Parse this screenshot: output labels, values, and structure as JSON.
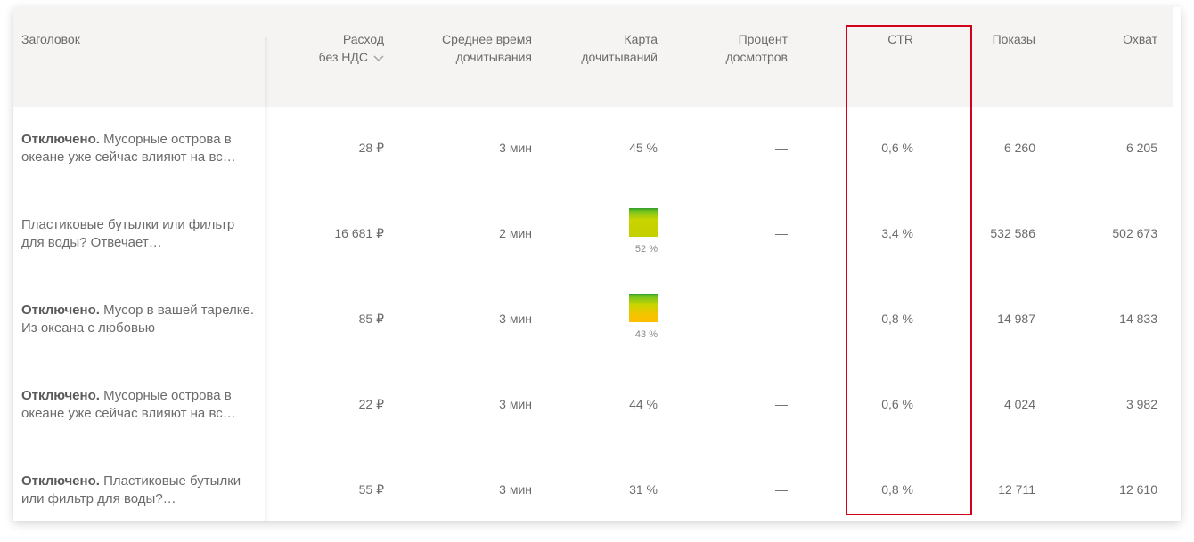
{
  "columns": {
    "title": "Заголовок",
    "expense_line1": "Расход",
    "expense_line2": "без НДС",
    "avg_time_line1": "Среднее время",
    "avg_time_line2": "дочитывания",
    "map_line1": "Карта",
    "map_line2": "дочитываний",
    "percent_line1": "Процент",
    "percent_line2": "досмотров",
    "ctr": "CTR",
    "shows": "Показы",
    "reach": "Охват"
  },
  "rows": [
    {
      "status": "Отключено.",
      "title": " Мусорные острова в океане уже сейчас влияют на вс…",
      "expense": "28 ₽",
      "time": "3 мин",
      "map": "45 %",
      "map_fill": null,
      "percent": "—",
      "ctr": "0,6 %",
      "shows": "6 260",
      "reach": "6 205"
    },
    {
      "status": "",
      "title": "Пластиковые бутылки или фильтр для воды? Отвечает…",
      "expense": "16 681 ₽",
      "time": "2 мин",
      "map": "52 %",
      "map_fill": 0.52,
      "percent": "—",
      "ctr": "3,4 %",
      "shows": "532 586",
      "reach": "502 673"
    },
    {
      "status": "Отключено.",
      "title": " Мусор в вашей тарелке. Из океана с любовью",
      "expense": "85 ₽",
      "time": "3 мин",
      "map": "43 %",
      "map_fill": 0.43,
      "percent": "—",
      "ctr": "0,8 %",
      "shows": "14 987",
      "reach": "14 833"
    },
    {
      "status": "Отключено.",
      "title": " Мусорные острова в океане уже сейчас влияют на вс…",
      "expense": "22 ₽",
      "time": "3 мин",
      "map": "44 %",
      "map_fill": null,
      "percent": "—",
      "ctr": "0,6 %",
      "shows": "4 024",
      "reach": "3 982"
    },
    {
      "status": "Отключено.",
      "title": " Пластиковые бутылки или фильтр для воды?…",
      "expense": "55 ₽",
      "time": "3 мин",
      "map": "31 %",
      "map_fill": null,
      "percent": "—",
      "ctr": "0,8 %",
      "shows": "12 711",
      "reach": "12 610"
    }
  ],
  "icons": {
    "sort": "chevron-down-icon"
  },
  "colors": {
    "highlight": "#d0021b",
    "header_bg": "#f5f4f2"
  }
}
